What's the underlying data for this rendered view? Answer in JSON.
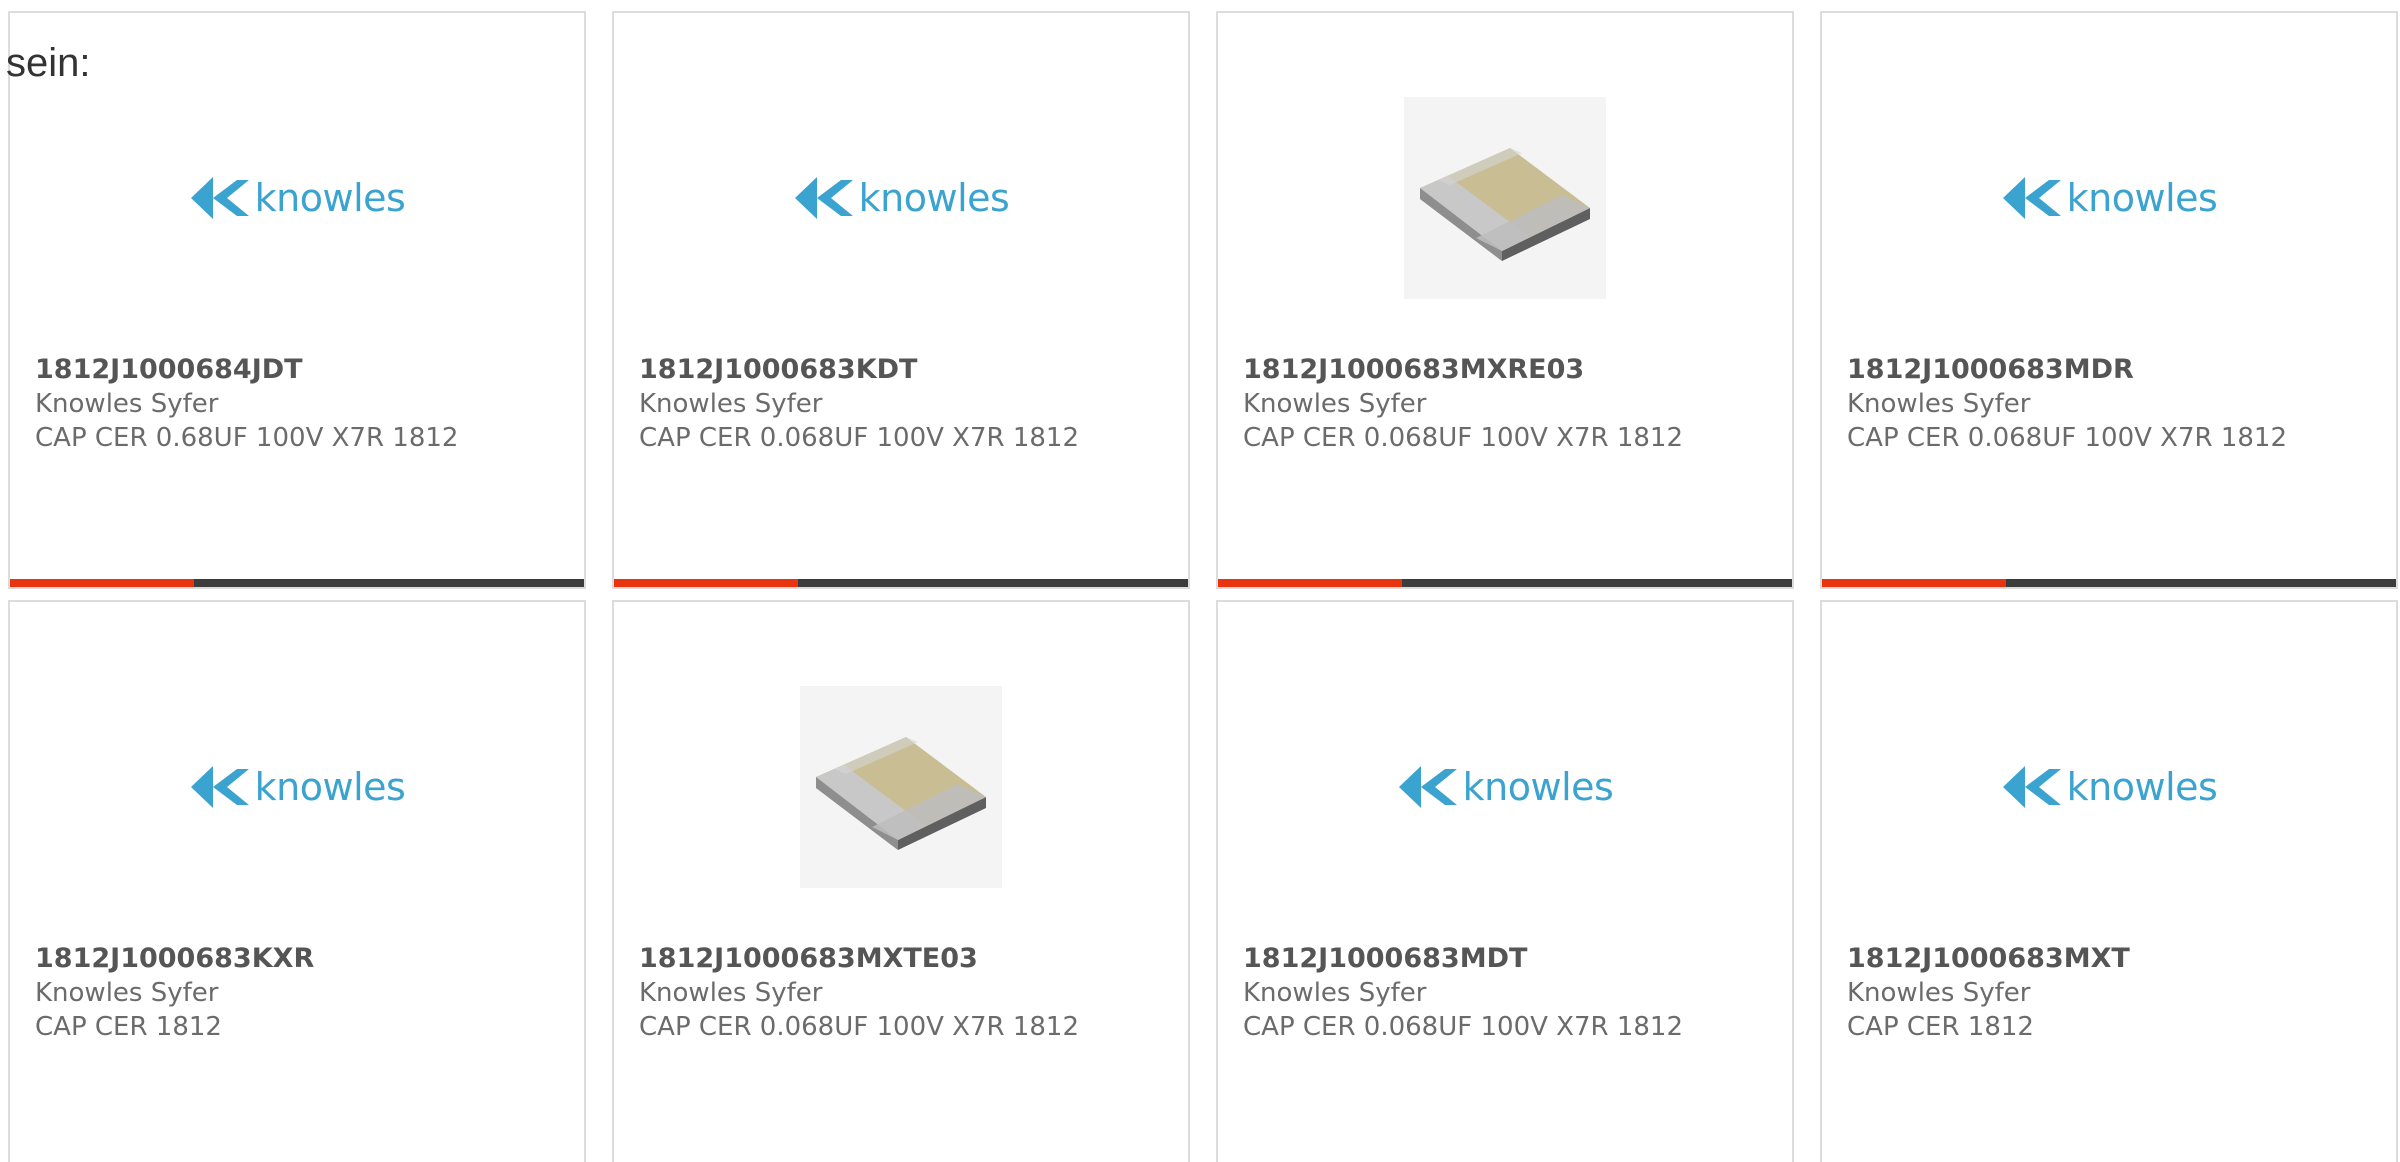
{
  "intro_text": "sein:",
  "colors": {
    "accent": "#e8350f",
    "bar_track": "#3c3c3c",
    "logo_blue": "#3aa3cf",
    "border": "#dcdcdc"
  },
  "logo": {
    "wordmark": "knowles",
    "icon": "knowles-logo-icon"
  },
  "products": [
    {
      "part": "1812J1000684JDT",
      "manufacturer": "Knowles Syfer",
      "description": "CAP CER 0.68UF 100V X7R 1812",
      "image": "knowles-logo",
      "bar_progress": 0.32
    },
    {
      "part": "1812J1000683KDT",
      "manufacturer": "Knowles Syfer",
      "description": "CAP CER 0.068UF 100V X7R 1812",
      "image": "knowles-logo",
      "bar_progress": 0.32
    },
    {
      "part": "1812J1000683MXRE03",
      "manufacturer": "Knowles Syfer",
      "description": "CAP CER 0.068UF 100V X7R 1812",
      "image": "chip-capacitor",
      "bar_progress": 0.32
    },
    {
      "part": "1812J1000683MDR",
      "manufacturer": "Knowles Syfer",
      "description": "CAP CER 0.068UF 100V X7R 1812",
      "image": "knowles-logo",
      "bar_progress": 0.32
    },
    {
      "part": "1812J1000683KXR",
      "manufacturer": "Knowles Syfer",
      "description": "CAP CER 1812",
      "image": "knowles-logo"
    },
    {
      "part": "1812J1000683MXTE03",
      "manufacturer": "Knowles Syfer",
      "description": "CAP CER 0.068UF 100V X7R 1812",
      "image": "chip-capacitor"
    },
    {
      "part": "1812J1000683MDT",
      "manufacturer": "Knowles Syfer",
      "description": "CAP CER 0.068UF 100V X7R 1812",
      "image": "knowles-logo"
    },
    {
      "part": "1812J1000683MXT",
      "manufacturer": "Knowles Syfer",
      "description": "CAP CER 1812",
      "image": "knowles-logo"
    }
  ]
}
